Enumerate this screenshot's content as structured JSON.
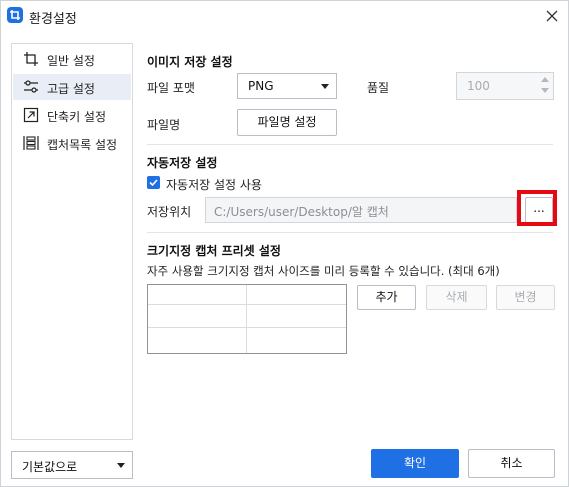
{
  "window": {
    "title": "환경설정"
  },
  "sidebar": {
    "items": [
      {
        "label": "일반 설정",
        "icon": "crop-icon",
        "active": false
      },
      {
        "label": "고급 설정",
        "icon": "sliders-icon",
        "active": true
      },
      {
        "label": "단축키 설정",
        "icon": "shortcut-icon",
        "active": false
      },
      {
        "label": "캡처목록 설정",
        "icon": "capture-list-icon",
        "active": false
      }
    ]
  },
  "image_save": {
    "title": "이미지 저장 설정",
    "format_label": "파일 포맷",
    "format_value": "PNG",
    "quality_label": "품질",
    "quality_value": "100",
    "filename_label": "파일명",
    "filename_button": "파일명 설정"
  },
  "auto_save": {
    "title": "자동저장 설정",
    "checkbox_label": "자동저장 설정 사용",
    "checked": true,
    "location_label": "저장위치",
    "location_value": "C:/Users/user/Desktop/알 캡처",
    "browse_button": "..."
  },
  "preset": {
    "title": "크기지정 캡처 프리셋 설정",
    "description": "자주 사용할 크기지정 캡처 사이즈를 미리 등록할 수 있습니다. (최대 6개)",
    "add_button": "추가",
    "delete_button": "삭제",
    "edit_button": "변경"
  },
  "footer": {
    "reset_select": "기본값으로",
    "ok_button": "확인",
    "cancel_button": "취소"
  },
  "colors": {
    "accent": "#1f6fe5",
    "highlight": "#e50914",
    "sidebar_active": "#e9eef6"
  }
}
